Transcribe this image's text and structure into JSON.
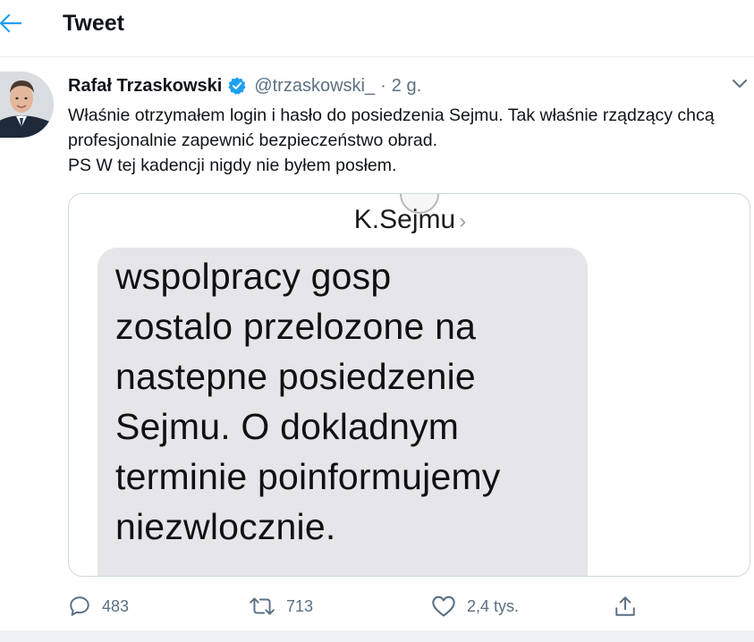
{
  "header": {
    "title": "Tweet",
    "back_icon": "arrow-left-icon"
  },
  "tweet": {
    "author_name": "Rafał Trzaskowski",
    "verified": true,
    "handle": "@trzaskowski_",
    "separator": "·",
    "time": "2 g.",
    "text_lines": [
      "Właśnie otrzymałem login i hasło do posiedzenia Sejmu. Tak właśnie rządzący chcą profesjonalnie zapewnić bezpieczeństwo obrad.",
      "PS W tej kadencji nigdy nie byłem posłem."
    ]
  },
  "media": {
    "contact_name": "K.Sejmu",
    "contact_chevron": "›",
    "sms_lines": [
      "wspolpracy gosp",
      "zostalo przelozone na",
      "nastepne posiedzenie",
      "Sejmu. O dokladnym",
      "terminie poinformujemy",
      "niezwlocznie."
    ]
  },
  "actions": {
    "reply": {
      "icon": "reply-icon",
      "count": "483"
    },
    "retweet": {
      "icon": "retweet-icon",
      "count": "713"
    },
    "like": {
      "icon": "heart-icon",
      "count": "2,4 tys."
    },
    "share": {
      "icon": "share-icon"
    }
  },
  "colors": {
    "accent": "#1da1f2",
    "secondary_text": "#5b7083",
    "primary_text": "#0f1419",
    "border": "#e6ecf0",
    "sms_bubble": "#e5e5ea"
  }
}
